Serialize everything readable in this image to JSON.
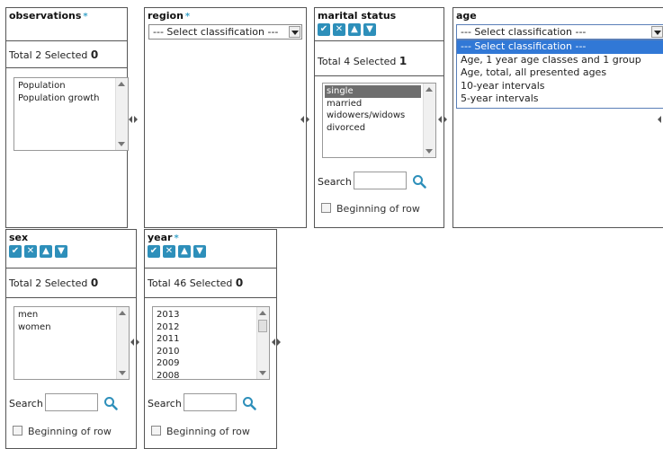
{
  "observations": {
    "title": "observations",
    "required_marker": "*",
    "total_label": "Total",
    "total": "2",
    "selected_label": "Selected",
    "selected": "0",
    "items": [
      "Population",
      "Population growth"
    ]
  },
  "region": {
    "title": "region",
    "required_marker": "*",
    "select_value": "--- Select classification ---"
  },
  "marital_status": {
    "title": "marital status",
    "total_label": "Total",
    "total": "4",
    "selected_label": "Selected",
    "selected": "1",
    "items": [
      "single",
      "married",
      "widowers/widows",
      "divorced"
    ],
    "selected_item": "single",
    "search_label": "Search",
    "beginning_label": "Beginning of row"
  },
  "age": {
    "title": "age",
    "select_value": "--- Select classification ---",
    "options": [
      "--- Select classification ---",
      "Age, 1 year age classes and 1 group",
      "Age, total, all presented ages",
      "10-year intervals",
      "5-year intervals"
    ]
  },
  "sex": {
    "title": "sex",
    "total_label": "Total",
    "total": "2",
    "selected_label": "Selected",
    "selected": "0",
    "items": [
      "men",
      "women"
    ],
    "search_label": "Search",
    "beginning_label": "Beginning of row"
  },
  "year": {
    "title": "year",
    "required_marker": "*",
    "total_label": "Total",
    "total": "46",
    "selected_label": "Selected",
    "selected": "0",
    "items": [
      "2013",
      "2012",
      "2011",
      "2010",
      "2009",
      "2008"
    ],
    "search_label": "Search",
    "beginning_label": "Beginning of row"
  },
  "icons": {
    "select_all": "check-icon",
    "deselect_all": "x-icon",
    "sort_up": "arrow-up-icon",
    "sort_down": "arrow-down-icon",
    "search": "magnifier-icon",
    "resize": "resize-handle-icon"
  },
  "colors": {
    "accent": "#2d8fba",
    "selected_row": "#6e6e6e",
    "dropdown_highlight": "#3178d6"
  }
}
